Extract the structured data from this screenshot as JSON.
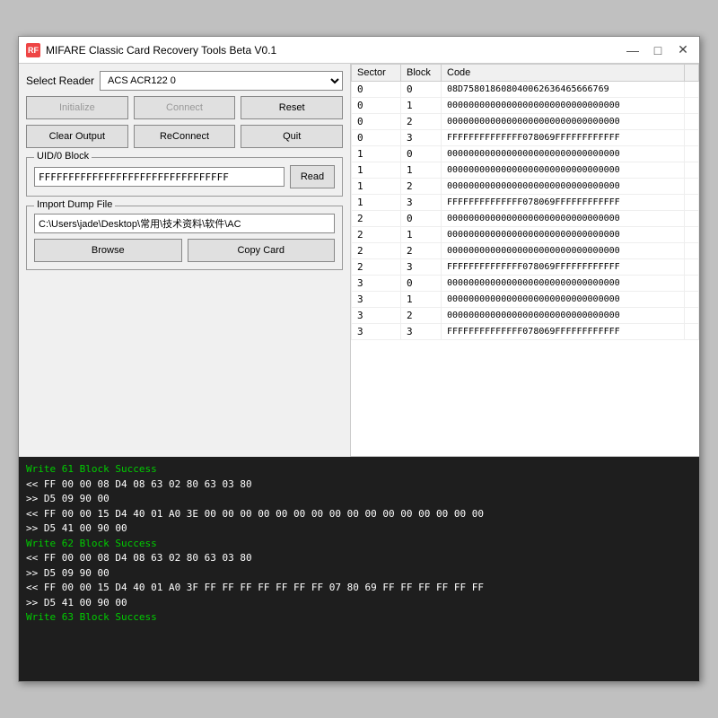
{
  "window": {
    "title": "MIFARE Classic Card Recovery Tools Beta V0.1",
    "icon": "RF"
  },
  "titleButtons": {
    "minimize": "—",
    "maximize": "□",
    "close": "✕"
  },
  "leftPanel": {
    "readerLabel": "Select Reader",
    "readerValue": "ACS ACR122 0",
    "initializeLabel": "Initialize",
    "connectLabel": "Connect",
    "resetLabel": "Reset",
    "clearOutputLabel": "Clear Output",
    "reconnectLabel": "ReConnect",
    "quitLabel": "Quit",
    "uidGroupLabel": "UID/0 Block",
    "uidValue": "FFFFFFFFFFFFFFFFFFFFFFFFFFFFFFFF",
    "readLabel": "Read",
    "importGroupLabel": "Import Dump File",
    "importPath": "C:\\Users\\jade\\Desktop\\常用\\技术资料\\软件\\AC",
    "browseLabel": "Browse",
    "copyCardLabel": "Copy Card"
  },
  "table": {
    "columns": [
      "Sector",
      "Block",
      "Code"
    ],
    "rows": [
      {
        "sector": "0",
        "block": "0",
        "code": "08D758018608040062636465666769"
      },
      {
        "sector": "0",
        "block": "1",
        "code": "00000000000000000000000000000000"
      },
      {
        "sector": "0",
        "block": "2",
        "code": "00000000000000000000000000000000"
      },
      {
        "sector": "0",
        "block": "3",
        "code": "FFFFFFFFFFFFFF078069FFFFFFFFFFFF"
      },
      {
        "sector": "1",
        "block": "0",
        "code": "00000000000000000000000000000000"
      },
      {
        "sector": "1",
        "block": "1",
        "code": "00000000000000000000000000000000"
      },
      {
        "sector": "1",
        "block": "2",
        "code": "00000000000000000000000000000000"
      },
      {
        "sector": "1",
        "block": "3",
        "code": "FFFFFFFFFFFFFF078069FFFFFFFFFFFF"
      },
      {
        "sector": "2",
        "block": "0",
        "code": "00000000000000000000000000000000"
      },
      {
        "sector": "2",
        "block": "1",
        "code": "00000000000000000000000000000000"
      },
      {
        "sector": "2",
        "block": "2",
        "code": "00000000000000000000000000000000"
      },
      {
        "sector": "2",
        "block": "3",
        "code": "FFFFFFFFFFFFFF078069FFFFFFFFFFFF"
      },
      {
        "sector": "3",
        "block": "0",
        "code": "00000000000000000000000000000000"
      },
      {
        "sector": "3",
        "block": "1",
        "code": "00000000000000000000000000000000"
      },
      {
        "sector": "3",
        "block": "2",
        "code": "00000000000000000000000000000000"
      },
      {
        "sector": "3",
        "block": "3",
        "code": "FFFFFFFFFFFFFF078069FFFFFFFFFFFF"
      }
    ]
  },
  "log": {
    "lines": [
      {
        "type": "green",
        "text": "Write 61 Block Success"
      },
      {
        "type": "white",
        "text": "<< FF 00 00 08 D4 08 63 02 80 63 03 80"
      },
      {
        "type": "white",
        "text": ">> D5 09 90 00"
      },
      {
        "type": "white",
        "text": "<< FF 00 00 15 D4 40 01 A0 3E 00 00 00 00 00 00 00 00 00 00 00 00 00 00 00 00"
      },
      {
        "type": "white",
        "text": ">> D5 41 00 90 00"
      },
      {
        "type": "green",
        "text": "Write 62 Block Success"
      },
      {
        "type": "white",
        "text": "<< FF 00 00 08 D4 08 63 02 80 63 03 80"
      },
      {
        "type": "white",
        "text": ">> D5 09 90 00"
      },
      {
        "type": "white",
        "text": "<< FF 00 00 15 D4 40 01 A0 3F FF FF FF FF FF FF FF 07 80 69 FF FF FF FF FF FF"
      },
      {
        "type": "white",
        "text": ">> D5 41 00 90 00"
      },
      {
        "type": "green",
        "text": "Write 63 Block Success"
      }
    ]
  }
}
